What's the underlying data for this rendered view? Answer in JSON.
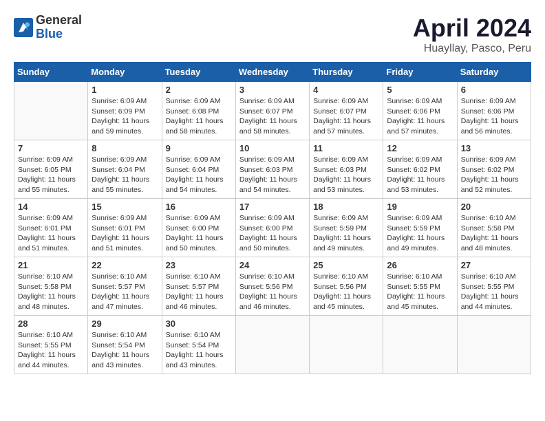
{
  "logo": {
    "general": "General",
    "blue": "Blue"
  },
  "title": "April 2024",
  "location": "Huayllay, Pasco, Peru",
  "weekdays": [
    "Sunday",
    "Monday",
    "Tuesday",
    "Wednesday",
    "Thursday",
    "Friday",
    "Saturday"
  ],
  "days": [
    {
      "num": "",
      "detail": ""
    },
    {
      "num": "1",
      "detail": "Sunrise: 6:09 AM\nSunset: 6:09 PM\nDaylight: 11 hours\nand 59 minutes."
    },
    {
      "num": "2",
      "detail": "Sunrise: 6:09 AM\nSunset: 6:08 PM\nDaylight: 11 hours\nand 58 minutes."
    },
    {
      "num": "3",
      "detail": "Sunrise: 6:09 AM\nSunset: 6:07 PM\nDaylight: 11 hours\nand 58 minutes."
    },
    {
      "num": "4",
      "detail": "Sunrise: 6:09 AM\nSunset: 6:07 PM\nDaylight: 11 hours\nand 57 minutes."
    },
    {
      "num": "5",
      "detail": "Sunrise: 6:09 AM\nSunset: 6:06 PM\nDaylight: 11 hours\nand 57 minutes."
    },
    {
      "num": "6",
      "detail": "Sunrise: 6:09 AM\nSunset: 6:06 PM\nDaylight: 11 hours\nand 56 minutes."
    },
    {
      "num": "7",
      "detail": "Sunrise: 6:09 AM\nSunset: 6:05 PM\nDaylight: 11 hours\nand 55 minutes."
    },
    {
      "num": "8",
      "detail": "Sunrise: 6:09 AM\nSunset: 6:04 PM\nDaylight: 11 hours\nand 55 minutes."
    },
    {
      "num": "9",
      "detail": "Sunrise: 6:09 AM\nSunset: 6:04 PM\nDaylight: 11 hours\nand 54 minutes."
    },
    {
      "num": "10",
      "detail": "Sunrise: 6:09 AM\nSunset: 6:03 PM\nDaylight: 11 hours\nand 54 minutes."
    },
    {
      "num": "11",
      "detail": "Sunrise: 6:09 AM\nSunset: 6:03 PM\nDaylight: 11 hours\nand 53 minutes."
    },
    {
      "num": "12",
      "detail": "Sunrise: 6:09 AM\nSunset: 6:02 PM\nDaylight: 11 hours\nand 53 minutes."
    },
    {
      "num": "13",
      "detail": "Sunrise: 6:09 AM\nSunset: 6:02 PM\nDaylight: 11 hours\nand 52 minutes."
    },
    {
      "num": "14",
      "detail": "Sunrise: 6:09 AM\nSunset: 6:01 PM\nDaylight: 11 hours\nand 51 minutes."
    },
    {
      "num": "15",
      "detail": "Sunrise: 6:09 AM\nSunset: 6:01 PM\nDaylight: 11 hours\nand 51 minutes."
    },
    {
      "num": "16",
      "detail": "Sunrise: 6:09 AM\nSunset: 6:00 PM\nDaylight: 11 hours\nand 50 minutes."
    },
    {
      "num": "17",
      "detail": "Sunrise: 6:09 AM\nSunset: 6:00 PM\nDaylight: 11 hours\nand 50 minutes."
    },
    {
      "num": "18",
      "detail": "Sunrise: 6:09 AM\nSunset: 5:59 PM\nDaylight: 11 hours\nand 49 minutes."
    },
    {
      "num": "19",
      "detail": "Sunrise: 6:09 AM\nSunset: 5:59 PM\nDaylight: 11 hours\nand 49 minutes."
    },
    {
      "num": "20",
      "detail": "Sunrise: 6:10 AM\nSunset: 5:58 PM\nDaylight: 11 hours\nand 48 minutes."
    },
    {
      "num": "21",
      "detail": "Sunrise: 6:10 AM\nSunset: 5:58 PM\nDaylight: 11 hours\nand 48 minutes."
    },
    {
      "num": "22",
      "detail": "Sunrise: 6:10 AM\nSunset: 5:57 PM\nDaylight: 11 hours\nand 47 minutes."
    },
    {
      "num": "23",
      "detail": "Sunrise: 6:10 AM\nSunset: 5:57 PM\nDaylight: 11 hours\nand 46 minutes."
    },
    {
      "num": "24",
      "detail": "Sunrise: 6:10 AM\nSunset: 5:56 PM\nDaylight: 11 hours\nand 46 minutes."
    },
    {
      "num": "25",
      "detail": "Sunrise: 6:10 AM\nSunset: 5:56 PM\nDaylight: 11 hours\nand 45 minutes."
    },
    {
      "num": "26",
      "detail": "Sunrise: 6:10 AM\nSunset: 5:55 PM\nDaylight: 11 hours\nand 45 minutes."
    },
    {
      "num": "27",
      "detail": "Sunrise: 6:10 AM\nSunset: 5:55 PM\nDaylight: 11 hours\nand 44 minutes."
    },
    {
      "num": "28",
      "detail": "Sunrise: 6:10 AM\nSunset: 5:55 PM\nDaylight: 11 hours\nand 44 minutes."
    },
    {
      "num": "29",
      "detail": "Sunrise: 6:10 AM\nSunset: 5:54 PM\nDaylight: 11 hours\nand 43 minutes."
    },
    {
      "num": "30",
      "detail": "Sunrise: 6:10 AM\nSunset: 5:54 PM\nDaylight: 11 hours\nand 43 minutes."
    },
    {
      "num": "",
      "detail": ""
    },
    {
      "num": "",
      "detail": ""
    },
    {
      "num": "",
      "detail": ""
    },
    {
      "num": "",
      "detail": ""
    }
  ]
}
